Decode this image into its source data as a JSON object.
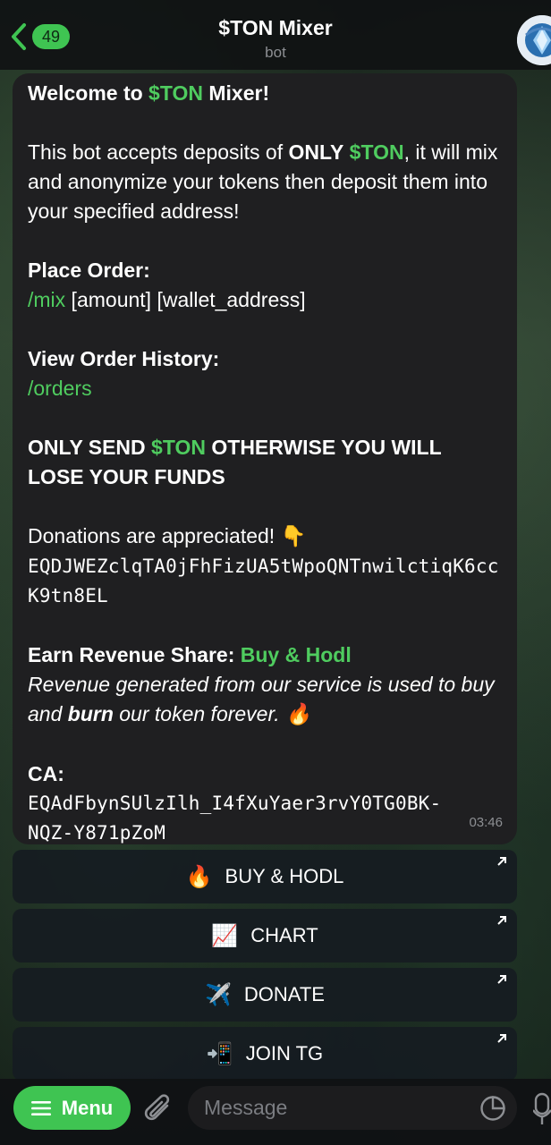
{
  "header": {
    "back_badge": "49",
    "title": "$TON Mixer",
    "subtitle": "bot"
  },
  "message": {
    "welcome_prefix": "Welcome to ",
    "welcome_token": "$TON",
    "welcome_suffix": " Mixer!",
    "intro_1": "This bot accepts deposits of ",
    "intro_only": "ONLY",
    "intro_space": " ",
    "intro_token": "$TON",
    "intro_2": ", it will mix and anonymize your tokens then deposit them into your specified address!",
    "place_order_label": "Place Order:",
    "mix_command": "/mix",
    "mix_args": " [amount] [wallet_address]",
    "history_label": "View Order History:",
    "orders_command": "/orders",
    "warning_1": "ONLY SEND ",
    "warning_token": "$TON",
    "warning_2": " OTHERWISE YOU WILL LOSE YOUR FUNDS",
    "donations_text": "Donations are appreciated! ",
    "donations_emoji": "👇",
    "donation_address": "EQDJWEZclqTA0jFhFizUA5tWpoQNTnwilctiqK6ccK9tn8EL",
    "revenue_label": "Earn Revenue Share: ",
    "revenue_link": "Buy & Hodl",
    "revenue_text_1": "Revenue generated from our service is used to buy and ",
    "revenue_burn": "burn",
    "revenue_text_2": " our token forever. ",
    "revenue_emoji": "🔥",
    "ca_label": "CA:",
    "ca_address": "EQAdFbynSUlzIlh_I4fXuYaer3rvY0TG0BK-NQZ-Y871pZoM",
    "time": "03:46"
  },
  "inline_buttons": [
    {
      "icon": "🔥",
      "label": "BUY & HODL"
    },
    {
      "icon": "📈",
      "label": "CHART"
    },
    {
      "icon": "✈️",
      "label": "DONATE"
    },
    {
      "icon": "📲",
      "label": "JOIN TG"
    }
  ],
  "bottom_bar": {
    "menu_label": "Menu",
    "input_placeholder": "Message"
  },
  "colors": {
    "accent_green": "#4fcc5f",
    "bubble_bg": "#1f1f21",
    "badge_bg": "#3fc452"
  }
}
